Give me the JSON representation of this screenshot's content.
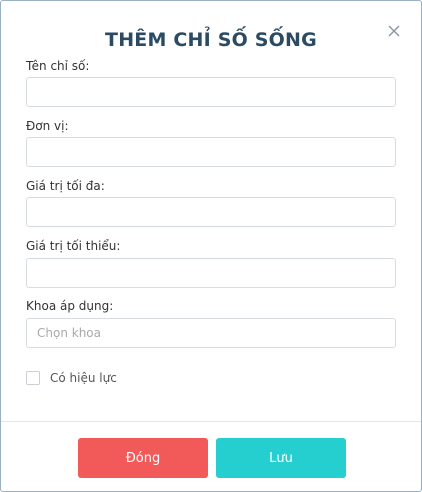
{
  "dialog": {
    "title": "THÊM CHỈ SỐ SỐNG",
    "close_icon": "close-x-icon"
  },
  "fields": {
    "name": {
      "label": "Tên chỉ số:",
      "value": "",
      "placeholder": ""
    },
    "unit": {
      "label": "Đơn vị:",
      "value": "",
      "placeholder": ""
    },
    "max_value": {
      "label": "Giá trị tối đa:",
      "value": "",
      "placeholder": ""
    },
    "min_value": {
      "label": "Giá trị tối thiểu:",
      "value": "",
      "placeholder": ""
    },
    "department": {
      "label": "Khoa áp dụng:",
      "value": "",
      "placeholder": "Chọn khoa"
    }
  },
  "active": {
    "label": "Có hiệu lực",
    "checked": false
  },
  "buttons": {
    "close_label": "Đóng",
    "save_label": "Lưu"
  },
  "colors": {
    "title": "#2b4a64",
    "close_button": "#f25a5a",
    "save_button": "#25cfcf",
    "border": "#d7dce1"
  }
}
